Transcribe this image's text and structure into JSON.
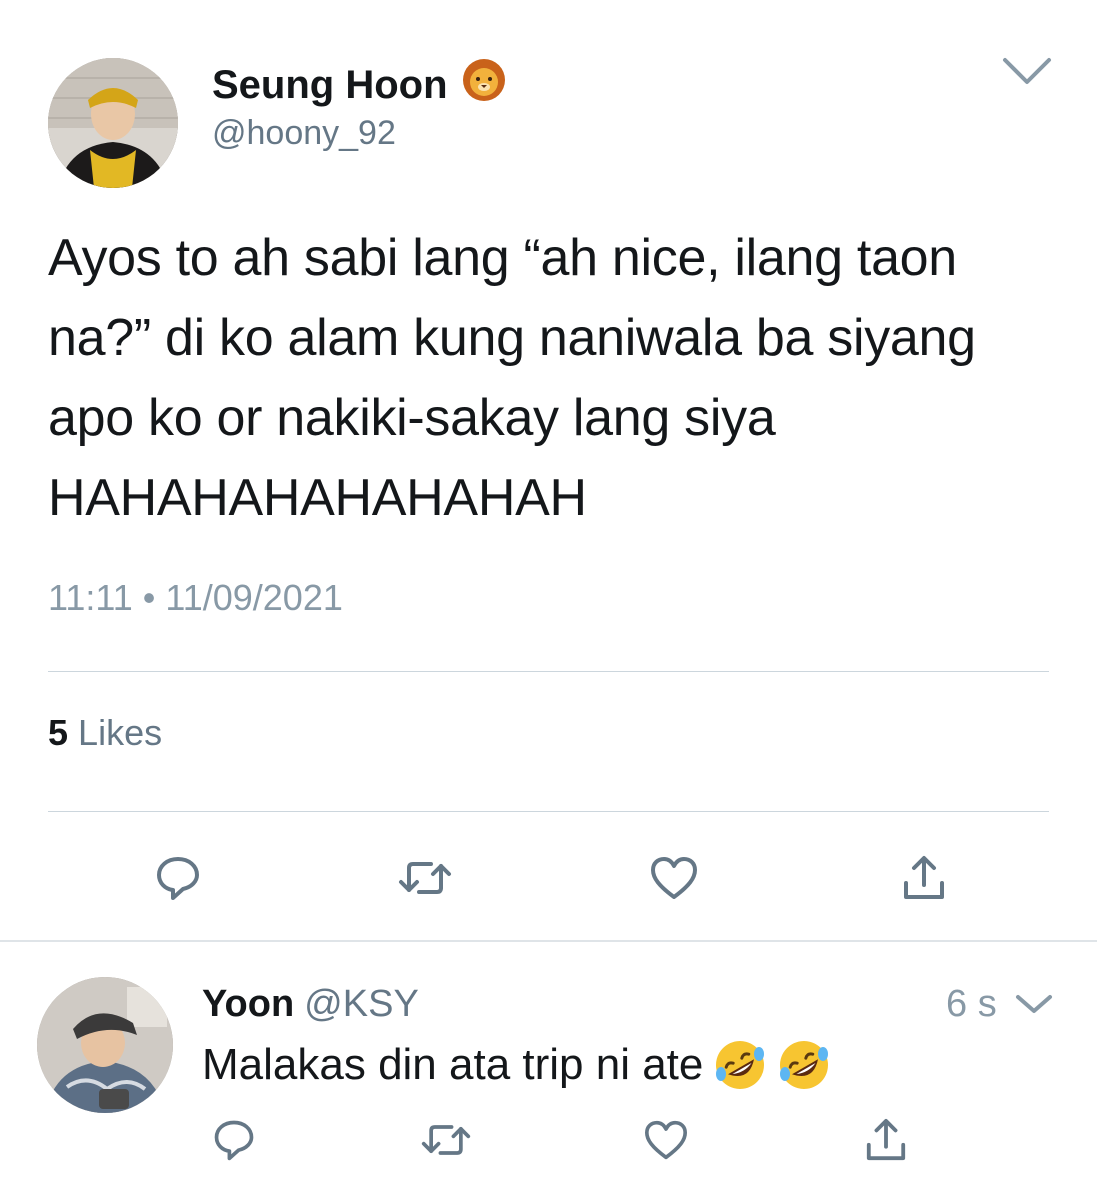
{
  "tweet": {
    "author": {
      "display_name": "Seung Hoon",
      "handle": "@hoony_92",
      "badge_icon": "lion-face-icon"
    },
    "text": "Ayos to ah sabi lang “ah nice, ilang taon na?” di ko alam kung naniwala ba siyang apo ko or nakiki-sakay lang siya HAHAHAHAHAHAHAH",
    "timestamp": "11:11 • 11/09/2021",
    "likes_count": "5",
    "likes_label": "Likes",
    "actions": [
      "reply-icon",
      "retweet-icon",
      "like-icon",
      "share-icon"
    ]
  },
  "reply": {
    "author": {
      "display_name": "Yoon",
      "handle": "@KSY"
    },
    "time": "6 s",
    "text": "Malakas din ata trip ni ate",
    "emojis": [
      "rolling-on-floor-laughing-icon",
      "rolling-on-floor-laughing-icon"
    ],
    "actions": [
      "reply-icon",
      "retweet-icon",
      "like-icon",
      "share-icon"
    ]
  },
  "colors": {
    "text_primary": "#14171a",
    "text_secondary": "#657786",
    "icon_gray": "#657786",
    "divider": "#ccd6dd"
  }
}
